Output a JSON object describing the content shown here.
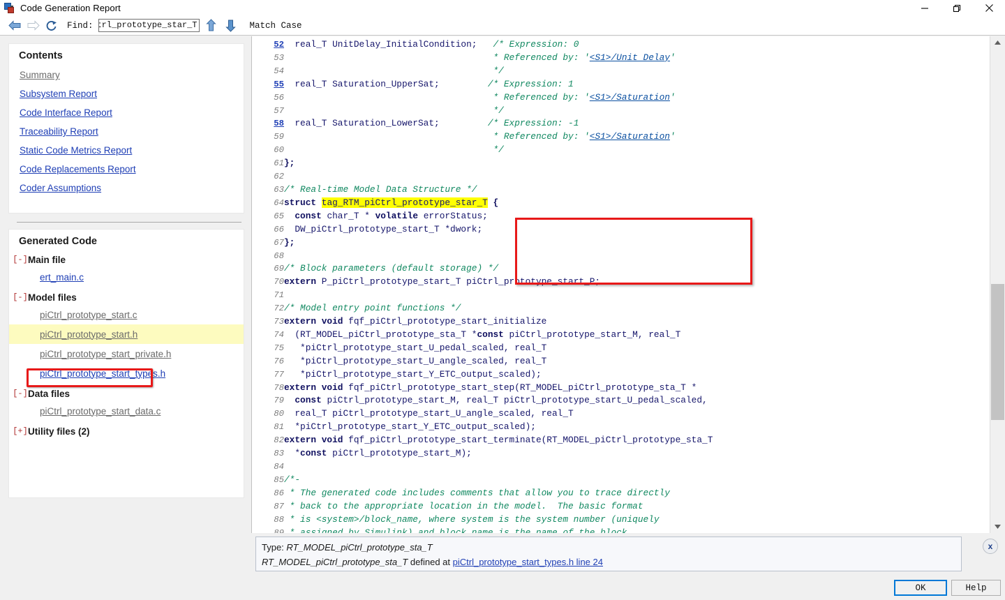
{
  "window": {
    "title": "Code Generation Report",
    "icon": "simulink-model-icon",
    "controls": {
      "minimize": "minimize-icon",
      "maximize": "maximize-icon",
      "close": "close-icon"
    }
  },
  "toolbar": {
    "back": "back-arrow-icon",
    "forward": "forward-arrow-icon",
    "refresh": "refresh-icon",
    "find_label": "Find:",
    "find_value": "iCtrl_prototype_star_T",
    "find_placeholder": "Find",
    "find_prev": "up-arrow-icon",
    "find_next": "down-arrow-icon",
    "match_case_label": "Match Case"
  },
  "sidebar": {
    "contents": {
      "header": "Contents",
      "links": [
        {
          "label": "Summary",
          "visited": true
        },
        {
          "label": "Subsystem Report",
          "visited": false
        },
        {
          "label": "Code Interface Report",
          "visited": false
        },
        {
          "label": "Traceability Report",
          "visited": false
        },
        {
          "label": "Static Code Metrics Report",
          "visited": false
        },
        {
          "label": "Code Replacements Report",
          "visited": false
        },
        {
          "label": "Coder Assumptions",
          "visited": false
        }
      ]
    },
    "generated_code": {
      "header": "Generated Code",
      "groups": [
        {
          "toggle": "[-]",
          "label": "Main file",
          "files": [
            {
              "label": "ert_main.c",
              "visited": false,
              "selected": false
            }
          ]
        },
        {
          "toggle": "[-]",
          "label": "Model files",
          "files": [
            {
              "label": "piCtrl_prototype_start.c",
              "visited": true,
              "selected": false
            },
            {
              "label": "piCtrl_prototype_start.h",
              "visited": true,
              "selected": true
            },
            {
              "label": "piCtrl_prototype_start_private.h",
              "visited": true,
              "selected": false
            },
            {
              "label": "piCtrl_prototype_start_types.h",
              "visited": false,
              "selected": false
            }
          ]
        },
        {
          "toggle": "[-]",
          "label": "Data files",
          "files": [
            {
              "label": "piCtrl_prototype_start_data.c",
              "visited": true,
              "selected": false
            }
          ]
        },
        {
          "toggle": "[+]",
          "label": "Utility files (2)",
          "files": []
        }
      ]
    }
  },
  "code": {
    "first_line": 52,
    "highlight_term": "tag_RTM_piCtrl_prototype_star_T",
    "lines": [
      {
        "n": 52,
        "link": true,
        "html": "  <span class='plain'>real_T UnitDelay_InitialCondition;</span>   <span class='cmt'>/* Expression: 0</span>"
      },
      {
        "n": 53,
        "link": false,
        "html": "                                      <span class='cmt'> * Referenced by: '</span><span class='lnk'>&lt;S1&gt;/Unit Delay</span><span class='cmt'>'</span>"
      },
      {
        "n": 54,
        "link": false,
        "html": "                                      <span class='cmt'> */</span>"
      },
      {
        "n": 55,
        "link": true,
        "html": "  <span class='plain'>real_T Saturation_UpperSat;</span>         <span class='cmt'>/* Expression: 1</span>"
      },
      {
        "n": 56,
        "link": false,
        "html": "                                      <span class='cmt'> * Referenced by: '</span><span class='lnk'>&lt;S1&gt;/Saturation</span><span class='cmt'>'</span>"
      },
      {
        "n": 57,
        "link": false,
        "html": "                                      <span class='cmt'> */</span>"
      },
      {
        "n": 58,
        "link": true,
        "html": "  <span class='plain'>real_T Saturation_LowerSat;</span>         <span class='cmt'>/* Expression: -1</span>"
      },
      {
        "n": 59,
        "link": false,
        "html": "                                      <span class='cmt'> * Referenced by: '</span><span class='lnk'>&lt;S1&gt;/Saturation</span><span class='cmt'>'</span>"
      },
      {
        "n": 60,
        "link": false,
        "html": "                                      <span class='cmt'> */</span>"
      },
      {
        "n": 61,
        "link": false,
        "html": "<span class='kw'>};</span>"
      },
      {
        "n": 62,
        "link": false,
        "html": ""
      },
      {
        "n": 63,
        "link": false,
        "html": "<span class='cmt'>/* Real-time Model Data Structure */</span>"
      },
      {
        "n": 64,
        "link": false,
        "html": "<span class='kw'>struct</span> <span class='hl plain'>tag_RTM_piCtrl_prototype_star_T</span> <span class='kw'>{</span>"
      },
      {
        "n": 65,
        "link": false,
        "html": "  <span class='kw'>const</span> <span class='plain'>char_T * </span><span class='kw'>volatile</span><span class='plain'> errorStatus;</span>"
      },
      {
        "n": 66,
        "link": false,
        "html": "  <span class='plain'>DW_piCtrl_prototype_start_T *dwork;</span>"
      },
      {
        "n": 67,
        "link": false,
        "html": "<span class='kw'>};</span>"
      },
      {
        "n": 68,
        "link": false,
        "html": ""
      },
      {
        "n": 69,
        "link": false,
        "html": "<span class='cmt'>/* Block parameters (default storage) */</span>"
      },
      {
        "n": 70,
        "link": false,
        "html": "<span class='kw'>extern</span> <span class='plain'>P_piCtrl_prototype_start_T piCtrl_prototype_start_P;</span>"
      },
      {
        "n": 71,
        "link": false,
        "html": ""
      },
      {
        "n": 72,
        "link": false,
        "html": "<span class='cmt'>/* Model entry point functions */</span>"
      },
      {
        "n": 73,
        "link": false,
        "html": "<span class='kw'>extern void</span> <span class='plain'>fqf_piCtrl_prototype_start_initialize</span>"
      },
      {
        "n": 74,
        "link": false,
        "html": "  <span class='plain'>(RT_MODEL_piCtrl_prototype_sta_T *</span><span class='kw'>const</span><span class='plain'> piCtrl_prototype_start_M, real_T</span>"
      },
      {
        "n": 75,
        "link": false,
        "html": "   <span class='plain'>*piCtrl_prototype_start_U_pedal_scaled, real_T</span>"
      },
      {
        "n": 76,
        "link": false,
        "html": "   <span class='plain'>*piCtrl_prototype_start_U_angle_scaled, real_T</span>"
      },
      {
        "n": 77,
        "link": false,
        "html": "   <span class='plain'>*piCtrl_prototype_start_Y_ETC_output_scaled);</span>"
      },
      {
        "n": 78,
        "link": false,
        "html": "<span class='kw'>extern void</span> <span class='plain'>fqf_piCtrl_prototype_start_step(RT_MODEL_piCtrl_prototype_sta_T *</span>"
      },
      {
        "n": 79,
        "link": false,
        "html": "  <span class='kw'>const</span> <span class='plain'>piCtrl_prototype_start_M, real_T piCtrl_prototype_start_U_pedal_scaled,</span>"
      },
      {
        "n": 80,
        "link": false,
        "html": "  <span class='plain'>real_T piCtrl_prototype_start_U_angle_scaled, real_T</span>"
      },
      {
        "n": 81,
        "link": false,
        "html": "  <span class='plain'>*piCtrl_prototype_start_Y_ETC_output_scaled);</span>"
      },
      {
        "n": 82,
        "link": false,
        "html": "<span class='kw'>extern void</span> <span class='plain'>fqf_piCtrl_prototype_start_terminate(RT_MODEL_piCtrl_prototype_sta_T</span>"
      },
      {
        "n": 83,
        "link": false,
        "html": "  <span class='plain'>*</span><span class='kw'>const</span><span class='plain'> piCtrl_prototype_start_M);</span>"
      },
      {
        "n": 84,
        "link": false,
        "html": ""
      },
      {
        "n": 85,
        "link": false,
        "html": "<span class='cmt'>/*-</span>"
      },
      {
        "n": 86,
        "link": false,
        "html": "<span class='cmt'> * The generated code includes comments that allow you to trace directly</span>"
      },
      {
        "n": 87,
        "link": false,
        "html": "<span class='cmt'> * back to the appropriate location in the model.  The basic format</span>"
      },
      {
        "n": 88,
        "link": false,
        "html": "<span class='cmt'> * is &lt;system&gt;/block_name, where system is the system number (uniquely</span>"
      },
      {
        "n": 89,
        "link": false,
        "html": "<span class='cmt'> * assigned by Simulink) and block_name is the name of the block.</span>"
      }
    ]
  },
  "infobar": {
    "line1_prefix": "Type: ",
    "line1_type": "RT_MODEL_piCtrl_prototype_sta_T",
    "line2_type": "RT_MODEL_piCtrl_prototype_sta_T",
    "line2_middle": " defined at ",
    "line2_link": "piCtrl_prototype_start_types.h line 24",
    "close_label": "x"
  },
  "footer": {
    "ok_label": "OK",
    "help_label": "Help"
  },
  "colors": {
    "accent_blue": "#0078d7",
    "link_blue": "#1f3fb5",
    "highlight_yellow": "#ffff00",
    "selection_yellow": "#fdfbbf",
    "red_box": "#e81919",
    "comment_green": "#108860"
  }
}
